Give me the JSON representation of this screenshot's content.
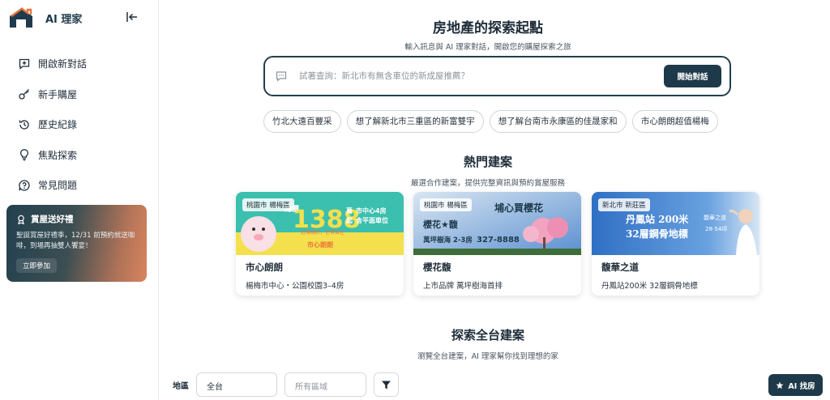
{
  "brand": {
    "name": "AI 理家"
  },
  "sidebar": {
    "items": [
      {
        "label": "開啟新對話",
        "icon": "new-chat-icon"
      },
      {
        "label": "新手購屋",
        "icon": "key-icon"
      },
      {
        "label": "歷史紀錄",
        "icon": "history-icon"
      },
      {
        "label": "焦點探索",
        "icon": "lightbulb-icon"
      },
      {
        "label": "常見問題",
        "icon": "help-icon"
      }
    ],
    "promo": {
      "title": "賞屋送好禮",
      "text": "聖誕賞屋好禮季，12/31 前預約就送咖啡，到場再抽雙人饗宴！",
      "button": "立即參加"
    }
  },
  "hero": {
    "title": "房地產的探索起點",
    "subtitle": "輸入訊息與 AI 理家對話，開啟您的購屋探索之旅",
    "search_placeholder": "試著查詢：新北市有無含車位的新成屋推薦？",
    "search_button": "開始對話",
    "chips": [
      "竹北大遠百豐采",
      "想了解新北市三重區的新富雙宇",
      "想了解台南市永康區的佳晟家和",
      "市心朗朗超值楊梅"
    ]
  },
  "hot": {
    "title": "熱門建案",
    "subtitle": "嚴選合作建案，提供完整資訊與預約賞屋服務",
    "cards": [
      {
        "tag": "桃園市 楊梅區",
        "name": "市心朗朗",
        "desc": "楊梅市中心・公園校園3–4房",
        "img": {
          "price_label": "總價",
          "price": "1388",
          "unit1": "萬",
          "unit2": "起",
          "line1": "市中心4房",
          "line2": "含平面車位",
          "brand": "市心朗朗",
          "tagline": "近得剛好，住得自在"
        }
      },
      {
        "tag": "桃園市 楊梅區",
        "name": "櫻花馥",
        "desc": "上市品牌 萬坪樹海首排",
        "img": {
          "headline": "埔心買櫻花",
          "brand": "櫻花★馥",
          "line": "萬坪樹海 2-3房",
          "phone": "327-8888"
        }
      },
      {
        "tag": "新北市 新莊區",
        "name": "馥華之道",
        "desc": "丹鳳站200米 32層鋼骨地標",
        "img": {
          "line1": "丹鳳站 200米",
          "line2": "32層鋼骨地標",
          "brand": "馥華之道",
          "size": "28-54坪"
        }
      }
    ]
  },
  "explore": {
    "title": "探索全台建案",
    "subtitle": "瀏覽全台建案，AI 理家幫你找到理想的家"
  },
  "filters": {
    "label": "地區",
    "city": "全台",
    "district_placeholder": "所有區域"
  },
  "fab": {
    "label": "AI 找房"
  },
  "colors": {
    "primary": "#1e3a4a",
    "accent_orange": "#e8743b"
  }
}
